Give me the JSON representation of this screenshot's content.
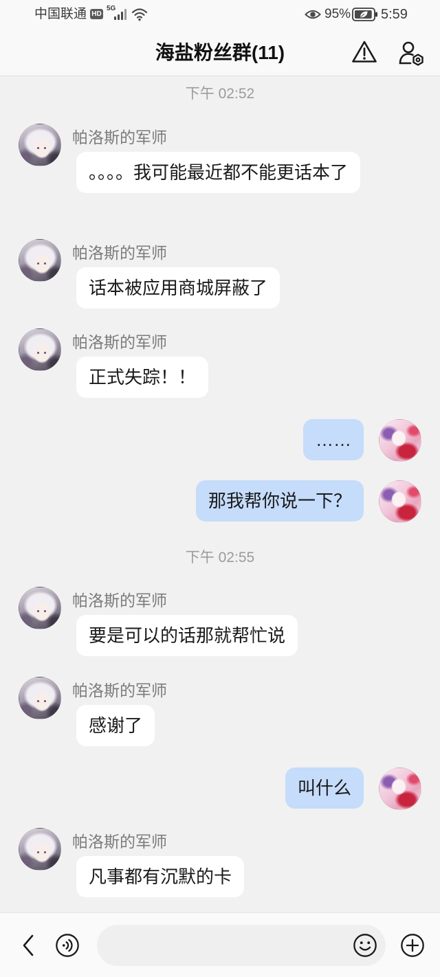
{
  "status_bar": {
    "carrier": "中国联通",
    "hd_badge": "HD",
    "network_type": "5G",
    "signal_icon": "signal-bars-icon",
    "wifi_icon": "wifi-icon",
    "eye_icon": "eye-comfort-icon",
    "battery_text": "95%",
    "battery_level": 0.95,
    "battery_icon": "battery-power-saving-icon",
    "time": "5:59"
  },
  "header": {
    "title": "海盐粉丝群(11)",
    "report_icon": "warning-icon",
    "settings_icon": "group-settings-icon"
  },
  "chat": {
    "messages": [
      {
        "timestamp": "下午 02:52"
      },
      {
        "sender": "帕洛斯的军师",
        "text": "。。。。我可能最近都不能更话本了",
        "from_me": false
      },
      {
        "sender": "帕洛斯的军师",
        "text": "话本被应用商城屏蔽了",
        "from_me": false
      },
      {
        "sender": "帕洛斯的军师",
        "text": "正式失踪！！",
        "from_me": false
      },
      {
        "text": "……",
        "from_me": true
      },
      {
        "text": "那我帮你说一下？",
        "from_me": true
      },
      {
        "timestamp": "下午 02:55"
      },
      {
        "sender": "帕洛斯的军师",
        "text": "要是可以的话那就帮忙说",
        "from_me": false
      },
      {
        "sender": "帕洛斯的军师",
        "text": "感谢了",
        "from_me": false
      },
      {
        "text": "叫什么",
        "from_me": true
      },
      {
        "sender": "帕洛斯的军师",
        "text": "凡事都有沉默的卡",
        "from_me": false
      }
    ]
  },
  "input_bar": {
    "value": "",
    "placeholder": "",
    "back_icon": "chevron-left-icon",
    "voice_icon": "voice-input-icon",
    "emoji_icon": "emoji-icon",
    "more_icon": "plus-circle-icon"
  },
  "colors": {
    "chat_background": "#f1f1f1",
    "incoming_bubble": "#ffffff",
    "outgoing_bubble": "#c5dcfb",
    "primary_text": "#1a1a1a",
    "secondary_text": "#7b7b7b",
    "timestamp_text": "#9b9b9b"
  }
}
